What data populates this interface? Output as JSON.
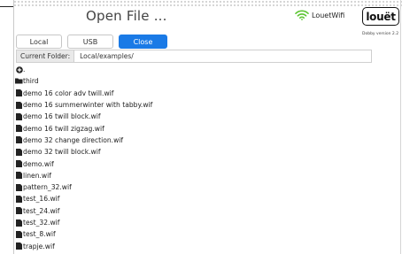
{
  "header": {
    "title": "Open File ...",
    "wifi_label": "LouetWifi",
    "logo_text": "louët",
    "version": "Dobby version 2.2",
    "wifi_color": "#5cc531"
  },
  "tabs": [
    {
      "label": "Local",
      "active": false
    },
    {
      "label": "USB",
      "active": false
    },
    {
      "label": "Close",
      "active": true
    }
  ],
  "folder": {
    "label": "Current Folder:",
    "value": "Local/examples/"
  },
  "files": [
    {
      "name": ".",
      "icon": "up-circle-icon"
    },
    {
      "name": "third",
      "icon": "folder-icon"
    },
    {
      "name": "demo 16 color adv twill.wif",
      "icon": "file-icon"
    },
    {
      "name": "demo 16 summerwinter with tabby.wif",
      "icon": "file-icon"
    },
    {
      "name": "demo 16 twill block.wif",
      "icon": "file-icon"
    },
    {
      "name": "demo 16 twill zigzag.wif",
      "icon": "file-icon"
    },
    {
      "name": "demo 32 change direction.wif",
      "icon": "file-icon"
    },
    {
      "name": "demo 32 twill block.wif",
      "icon": "file-icon"
    },
    {
      "name": "demo.wif",
      "icon": "file-icon"
    },
    {
      "name": "linen.wif",
      "icon": "file-icon"
    },
    {
      "name": "pattern_32.wif",
      "icon": "file-icon"
    },
    {
      "name": "test_16.wif",
      "icon": "file-icon"
    },
    {
      "name": "test_24.wif",
      "icon": "file-icon"
    },
    {
      "name": "test_32.wif",
      "icon": "file-icon"
    },
    {
      "name": "test_8.wif",
      "icon": "file-icon"
    },
    {
      "name": "trapje.wif",
      "icon": "file-icon"
    }
  ],
  "colors": {
    "accent": "#1a7ae6",
    "text": "#222222"
  }
}
